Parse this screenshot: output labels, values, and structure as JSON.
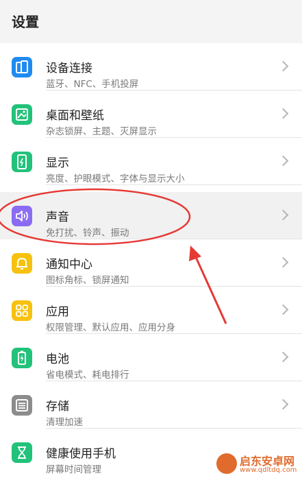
{
  "header": {
    "title": "设置"
  },
  "colors": {
    "accent_blue": "#1f8bf0",
    "accent_green": "#22c27a",
    "accent_purple": "#8a6cf2",
    "accent_yellow": "#f7c20f",
    "accent_gray": "#8c8c8c",
    "annotation_red": "#e53935"
  },
  "settings": {
    "items": [
      {
        "label": "设备连接",
        "sub": "蓝牙、NFC、手机投屏",
        "icon": "device-connection-icon"
      },
      {
        "label": "桌面和壁纸",
        "sub": "杂志锁屏、主题、灭屏显示",
        "icon": "wallpaper-icon"
      },
      {
        "label": "显示",
        "sub": "亮度、护眼模式、字体与显示大小",
        "icon": "display-icon"
      },
      {
        "label": "声音",
        "sub": "免打扰、铃声、振动",
        "icon": "sound-icon"
      },
      {
        "label": "通知中心",
        "sub": "图标角标、锁屏通知",
        "icon": "bell-icon"
      },
      {
        "label": "应用",
        "sub": "权限管理、默认应用、应用分身",
        "icon": "apps-grid-icon"
      },
      {
        "label": "电池",
        "sub": "省电模式、耗电排行",
        "icon": "battery-icon"
      },
      {
        "label": "存储",
        "sub": "清理加速",
        "icon": "storage-icon"
      },
      {
        "label": "健康使用手机",
        "sub": "屏幕时间管理",
        "icon": "hourglass-icon"
      }
    ]
  },
  "watermark": {
    "title": "启东安卓网",
    "url": "www.qdltdq.com"
  }
}
